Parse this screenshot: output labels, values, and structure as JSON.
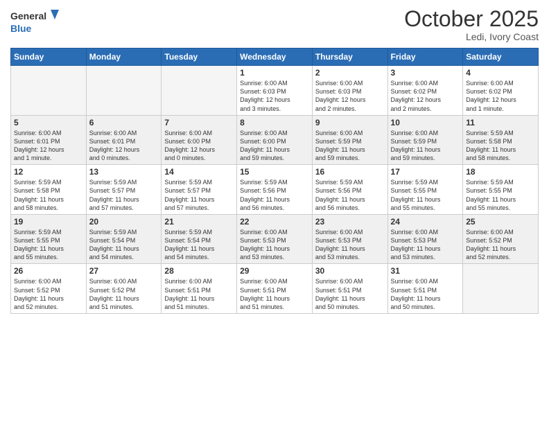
{
  "header": {
    "logo_general": "General",
    "logo_blue": "Blue",
    "month": "October 2025",
    "location": "Ledi, Ivory Coast"
  },
  "weekdays": [
    "Sunday",
    "Monday",
    "Tuesday",
    "Wednesday",
    "Thursday",
    "Friday",
    "Saturday"
  ],
  "weeks": [
    {
      "alt": false,
      "days": [
        {
          "num": "",
          "info": ""
        },
        {
          "num": "",
          "info": ""
        },
        {
          "num": "",
          "info": ""
        },
        {
          "num": "1",
          "info": "Sunrise: 6:00 AM\nSunset: 6:03 PM\nDaylight: 12 hours\nand 3 minutes."
        },
        {
          "num": "2",
          "info": "Sunrise: 6:00 AM\nSunset: 6:03 PM\nDaylight: 12 hours\nand 2 minutes."
        },
        {
          "num": "3",
          "info": "Sunrise: 6:00 AM\nSunset: 6:02 PM\nDaylight: 12 hours\nand 2 minutes."
        },
        {
          "num": "4",
          "info": "Sunrise: 6:00 AM\nSunset: 6:02 PM\nDaylight: 12 hours\nand 1 minute."
        }
      ]
    },
    {
      "alt": true,
      "days": [
        {
          "num": "5",
          "info": "Sunrise: 6:00 AM\nSunset: 6:01 PM\nDaylight: 12 hours\nand 1 minute."
        },
        {
          "num": "6",
          "info": "Sunrise: 6:00 AM\nSunset: 6:01 PM\nDaylight: 12 hours\nand 0 minutes."
        },
        {
          "num": "7",
          "info": "Sunrise: 6:00 AM\nSunset: 6:00 PM\nDaylight: 12 hours\nand 0 minutes."
        },
        {
          "num": "8",
          "info": "Sunrise: 6:00 AM\nSunset: 6:00 PM\nDaylight: 11 hours\nand 59 minutes."
        },
        {
          "num": "9",
          "info": "Sunrise: 6:00 AM\nSunset: 5:59 PM\nDaylight: 11 hours\nand 59 minutes."
        },
        {
          "num": "10",
          "info": "Sunrise: 6:00 AM\nSunset: 5:59 PM\nDaylight: 11 hours\nand 59 minutes."
        },
        {
          "num": "11",
          "info": "Sunrise: 5:59 AM\nSunset: 5:58 PM\nDaylight: 11 hours\nand 58 minutes."
        }
      ]
    },
    {
      "alt": false,
      "days": [
        {
          "num": "12",
          "info": "Sunrise: 5:59 AM\nSunset: 5:58 PM\nDaylight: 11 hours\nand 58 minutes."
        },
        {
          "num": "13",
          "info": "Sunrise: 5:59 AM\nSunset: 5:57 PM\nDaylight: 11 hours\nand 57 minutes."
        },
        {
          "num": "14",
          "info": "Sunrise: 5:59 AM\nSunset: 5:57 PM\nDaylight: 11 hours\nand 57 minutes."
        },
        {
          "num": "15",
          "info": "Sunrise: 5:59 AM\nSunset: 5:56 PM\nDaylight: 11 hours\nand 56 minutes."
        },
        {
          "num": "16",
          "info": "Sunrise: 5:59 AM\nSunset: 5:56 PM\nDaylight: 11 hours\nand 56 minutes."
        },
        {
          "num": "17",
          "info": "Sunrise: 5:59 AM\nSunset: 5:55 PM\nDaylight: 11 hours\nand 55 minutes."
        },
        {
          "num": "18",
          "info": "Sunrise: 5:59 AM\nSunset: 5:55 PM\nDaylight: 11 hours\nand 55 minutes."
        }
      ]
    },
    {
      "alt": true,
      "days": [
        {
          "num": "19",
          "info": "Sunrise: 5:59 AM\nSunset: 5:55 PM\nDaylight: 11 hours\nand 55 minutes."
        },
        {
          "num": "20",
          "info": "Sunrise: 5:59 AM\nSunset: 5:54 PM\nDaylight: 11 hours\nand 54 minutes."
        },
        {
          "num": "21",
          "info": "Sunrise: 5:59 AM\nSunset: 5:54 PM\nDaylight: 11 hours\nand 54 minutes."
        },
        {
          "num": "22",
          "info": "Sunrise: 6:00 AM\nSunset: 5:53 PM\nDaylight: 11 hours\nand 53 minutes."
        },
        {
          "num": "23",
          "info": "Sunrise: 6:00 AM\nSunset: 5:53 PM\nDaylight: 11 hours\nand 53 minutes."
        },
        {
          "num": "24",
          "info": "Sunrise: 6:00 AM\nSunset: 5:53 PM\nDaylight: 11 hours\nand 53 minutes."
        },
        {
          "num": "25",
          "info": "Sunrise: 6:00 AM\nSunset: 5:52 PM\nDaylight: 11 hours\nand 52 minutes."
        }
      ]
    },
    {
      "alt": false,
      "days": [
        {
          "num": "26",
          "info": "Sunrise: 6:00 AM\nSunset: 5:52 PM\nDaylight: 11 hours\nand 52 minutes."
        },
        {
          "num": "27",
          "info": "Sunrise: 6:00 AM\nSunset: 5:52 PM\nDaylight: 11 hours\nand 51 minutes."
        },
        {
          "num": "28",
          "info": "Sunrise: 6:00 AM\nSunset: 5:51 PM\nDaylight: 11 hours\nand 51 minutes."
        },
        {
          "num": "29",
          "info": "Sunrise: 6:00 AM\nSunset: 5:51 PM\nDaylight: 11 hours\nand 51 minutes."
        },
        {
          "num": "30",
          "info": "Sunrise: 6:00 AM\nSunset: 5:51 PM\nDaylight: 11 hours\nand 50 minutes."
        },
        {
          "num": "31",
          "info": "Sunrise: 6:00 AM\nSunset: 5:51 PM\nDaylight: 11 hours\nand 50 minutes."
        },
        {
          "num": "",
          "info": ""
        }
      ]
    }
  ]
}
